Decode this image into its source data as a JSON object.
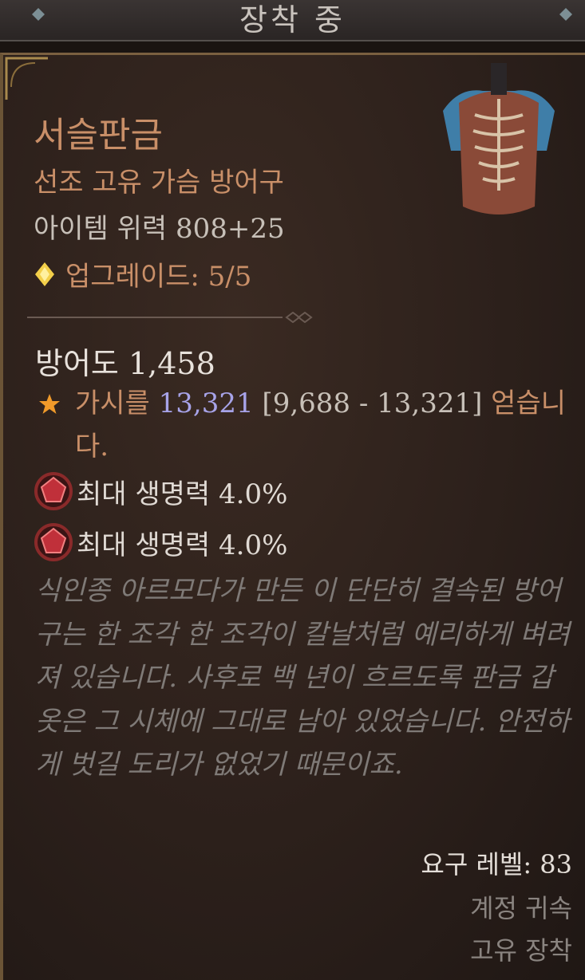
{
  "header": {
    "title": "장착 중"
  },
  "item": {
    "name": "서슬판금",
    "type": "선조 고유 가슴 방어구",
    "power": "아이템 위력 808+25",
    "upgrade": "업그레이드: 5/5",
    "armor": "방어도 1,458"
  },
  "thorns": {
    "prefix": "가시를 ",
    "value": "13,321",
    "range": " [9,688 - 13,321]",
    "suffix": " 얻습니다."
  },
  "affixes": [
    {
      "text": "최대 생명력 4.0%"
    },
    {
      "text": "최대 생명력 4.0%"
    }
  ],
  "flavor": "식인종 아르모다가 만든 이 단단히 결속된 방어구는 한 조각 한 조각이 칼날처럼 예리하게 벼려져 있습니다. 사후로 백 년이 흐르도록 판금 갑옷은 그 시체에 그대로 남아 있었습니다. 안전하게 벗길 도리가 없었기 때문이죠.",
  "footer": {
    "required_level": "요구 레벨: 83",
    "account_bound": "계정 귀속",
    "unique_equip": "고유 장착"
  },
  "icons": {
    "upgrade": "diamond-icon",
    "thorns": "star-icon",
    "affix": "red-gem-icon",
    "item": "chest-armor-icon"
  },
  "colors": {
    "unique": "#c98f68",
    "value_highlight": "#a7a3e8",
    "flavor": "#7f7a77",
    "background": "#2c201b"
  }
}
